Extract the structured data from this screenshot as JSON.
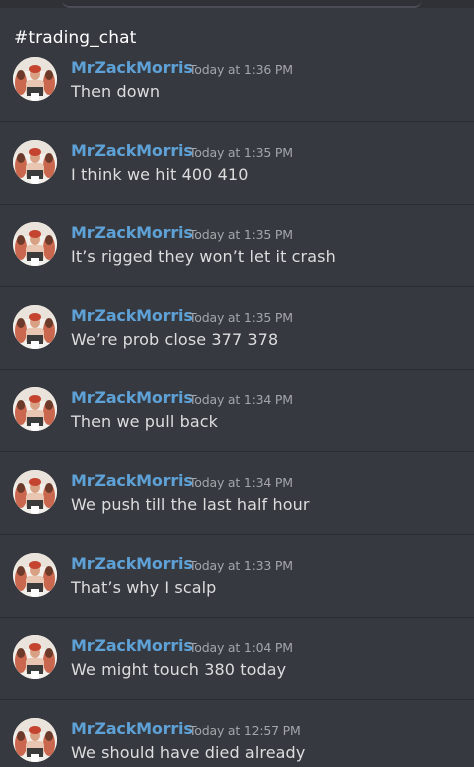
{
  "channel": {
    "name": "#trading_chat"
  },
  "messages": [
    {
      "author": "MrZackMorris",
      "time": "Today at 1:36 PM",
      "text": "Then down"
    },
    {
      "author": "MrZackMorris",
      "time": "Today at 1:35 PM",
      "text": "I think we hit 400 410"
    },
    {
      "author": "MrZackMorris",
      "time": "Today at 1:35 PM",
      "text": "It’s rigged they won’t let it crash"
    },
    {
      "author": "MrZackMorris",
      "time": "Today at 1:35 PM",
      "text": "We’re prob close 377 378"
    },
    {
      "author": "MrZackMorris",
      "time": "Today at 1:34 PM",
      "text": "Then we pull back"
    },
    {
      "author": "MrZackMorris",
      "time": "Today at 1:34 PM",
      "text": "We push till the last half hour"
    },
    {
      "author": "MrZackMorris",
      "time": "Today at 1:33 PM",
      "text": "That’s why I scalp"
    },
    {
      "author": "MrZackMorris",
      "time": "Today at 1:04 PM",
      "text": "We might touch 380 today"
    },
    {
      "author": "MrZackMorris",
      "time": "Today at 12:57 PM",
      "text": "We should have died already"
    }
  ],
  "colors": {
    "background": "#36393f",
    "username": "#5ea1d6",
    "timestamp": "#a3a6aa",
    "message_text": "#dcddde",
    "divider": "#2a2c31"
  }
}
